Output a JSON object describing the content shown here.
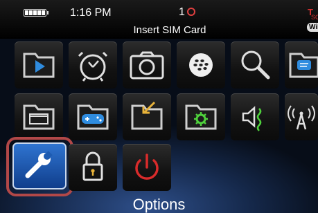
{
  "status_bar": {
    "time": "1:16 PM",
    "notification_count": "1",
    "network_message": "Insert SIM Card",
    "signal_text": "T",
    "sos_text": "SOS",
    "wifi_label": "WiFi"
  },
  "grid": {
    "rows": [
      [
        "media-icon",
        "alarm-icon",
        "camera-icon",
        "blackberry-messenger-icon",
        "search-icon",
        "messages-icon"
      ],
      [
        "browser-icon",
        "games-icon",
        "downloads-icon",
        "applications-icon",
        "sounds-icon",
        "manage-connections-icon"
      ],
      [
        "options-icon",
        "lock-icon",
        "power-icon"
      ]
    ],
    "selected": "options-icon"
  },
  "selected_label": "Options",
  "colors": {
    "selection_ring": "#b24848",
    "selected_tile": "#2f74d0",
    "power_red": "#d92b2b",
    "accent_yellow": "#e8b33a",
    "accent_green": "#4fd13c",
    "accent_blue": "#2f8cdf"
  }
}
